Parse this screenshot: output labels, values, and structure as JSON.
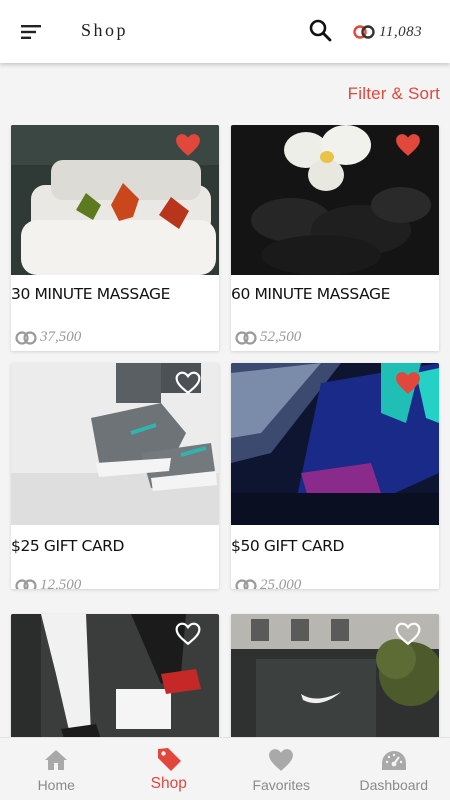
{
  "appbar": {
    "title": "Shop",
    "points": "11,083",
    "menu_icon": "menu-icon",
    "search_icon": "search-icon",
    "points_icon": "rings-icon"
  },
  "filter": {
    "label": "Filter & Sort"
  },
  "products": [
    {
      "name": "30 MINUTE MASSAGE",
      "price": "37,500",
      "favorited": true,
      "image": "towels-with-leaves-photo"
    },
    {
      "name": "60 MINUTE MASSAGE",
      "price": "52,500",
      "favorited": true,
      "image": "orchid-on-stones-photo"
    },
    {
      "name": "$25 GIFT CARD",
      "price": "12,500",
      "favorited": false,
      "image": "sneakers-photo"
    },
    {
      "name": "$50 GIFT CARD",
      "price": "25,000",
      "favorited": true,
      "image": "sneaker-graffiti-photo"
    },
    {
      "name": "",
      "price": "",
      "favorited": false,
      "image": "legs-sneakers-photo"
    },
    {
      "name": "",
      "price": "",
      "favorited": false,
      "image": "nike-store-photo"
    }
  ],
  "nav": {
    "items": [
      {
        "label": "Home",
        "icon": "home-icon",
        "active": false
      },
      {
        "label": "Shop",
        "icon": "tag-icon",
        "active": true
      },
      {
        "label": "Favorites",
        "icon": "heart-icon",
        "active": false
      },
      {
        "label": "Dashboard",
        "icon": "dashboard-icon",
        "active": false
      }
    ]
  },
  "colors": {
    "accent": "#e2473c",
    "heart_fill": "#e2473c",
    "muted": "#9a9a9a"
  }
}
